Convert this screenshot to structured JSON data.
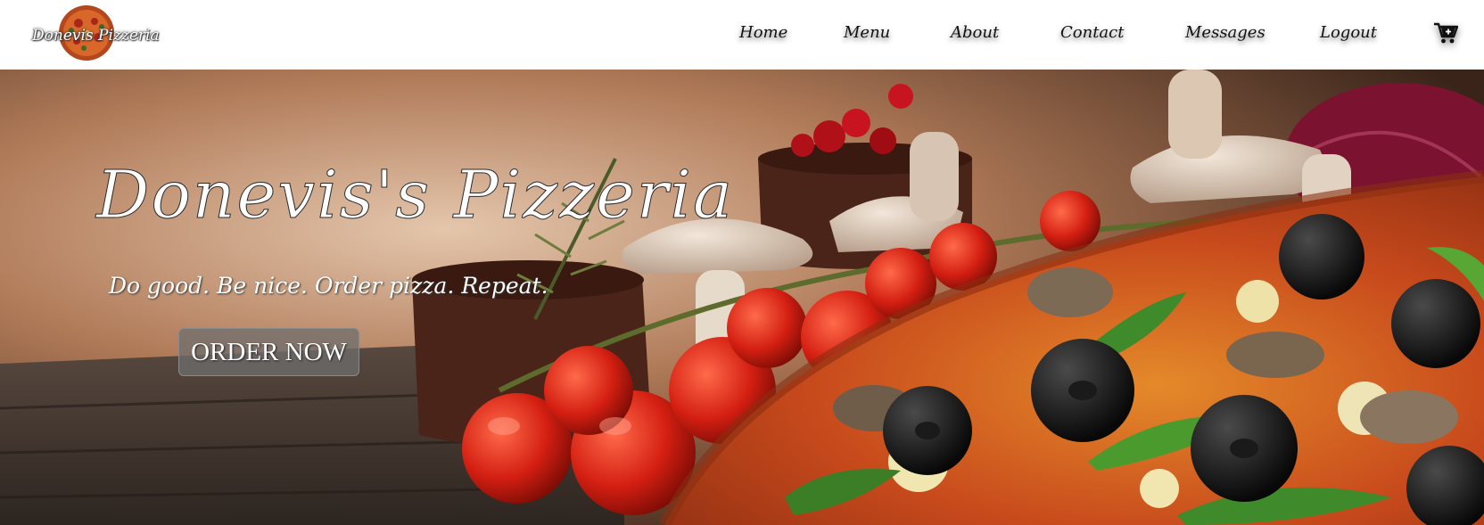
{
  "brand": {
    "logo_text": "Donevis Pizzeria",
    "logo_icon": "pizza-logo-icon"
  },
  "nav": {
    "items": [
      {
        "label": "Home"
      },
      {
        "label": "Menu"
      },
      {
        "label": "About"
      },
      {
        "label": "Contact"
      },
      {
        "label": "Messages"
      },
      {
        "label": "Logout"
      }
    ],
    "cart_icon": "cart-plus-icon"
  },
  "hero": {
    "title": "Donevis's Pizzeria",
    "tagline": "Do good. Be nice. Order pizza. Repeat.",
    "cta_label": "ORDER NOW"
  },
  "colors": {
    "header_bg": "#ffffff",
    "nav_text": "#111111",
    "hero_text": "#ffffff",
    "button_bg": "#6e6e6e"
  }
}
